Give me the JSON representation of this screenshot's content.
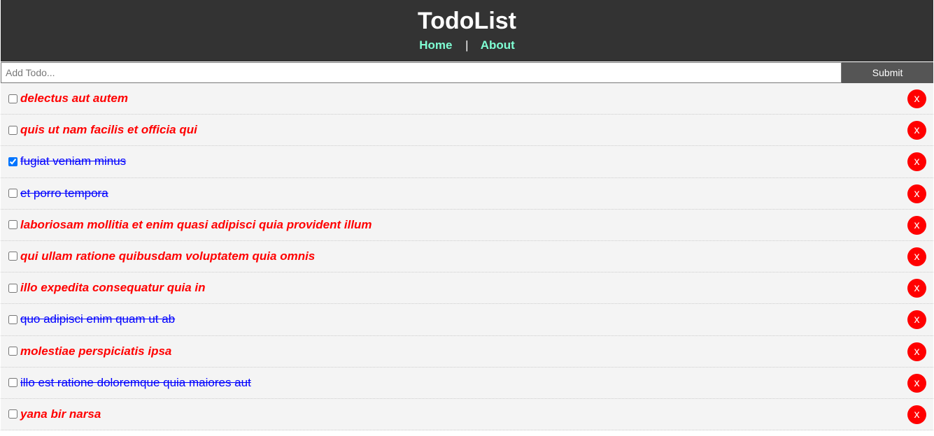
{
  "header": {
    "title": "TodoList",
    "nav": {
      "home": "Home",
      "separator": "|",
      "about": "About"
    }
  },
  "add_form": {
    "placeholder": "Add Todo...",
    "value": "",
    "submit_label": "Submit"
  },
  "colors": {
    "header_bg": "#333333",
    "nav_link": "#7fffd4",
    "submit_bg": "#555555",
    "item_bg": "#f4f4f4",
    "active_text": "#ff0000",
    "done_text": "#0000ff",
    "delete_bg": "#ff0000"
  },
  "todos": [
    {
      "title": "delectus aut autem",
      "checked": false,
      "style": "active",
      "delete_label": "x"
    },
    {
      "title": "quis ut nam facilis et officia qui",
      "checked": false,
      "style": "active",
      "delete_label": "x"
    },
    {
      "title": "fugiat veniam minus",
      "checked": true,
      "style": "done",
      "delete_label": "x"
    },
    {
      "title": "et porro tempora",
      "checked": false,
      "style": "done",
      "delete_label": "x"
    },
    {
      "title": "laboriosam mollitia et enim quasi adipisci quia provident illum",
      "checked": false,
      "style": "active",
      "delete_label": "x"
    },
    {
      "title": "qui ullam ratione quibusdam voluptatem quia omnis",
      "checked": false,
      "style": "active",
      "delete_label": "x"
    },
    {
      "title": "illo expedita consequatur quia in",
      "checked": false,
      "style": "active",
      "delete_label": "x"
    },
    {
      "title": "quo adipisci enim quam ut ab",
      "checked": false,
      "style": "done",
      "delete_label": "x"
    },
    {
      "title": "molestiae perspiciatis ipsa",
      "checked": false,
      "style": "active",
      "delete_label": "x"
    },
    {
      "title": "illo est ratione doloremque quia maiores aut",
      "checked": false,
      "style": "done",
      "delete_label": "x"
    },
    {
      "title": "yana bir narsa",
      "checked": false,
      "style": "active",
      "delete_label": "x"
    }
  ]
}
